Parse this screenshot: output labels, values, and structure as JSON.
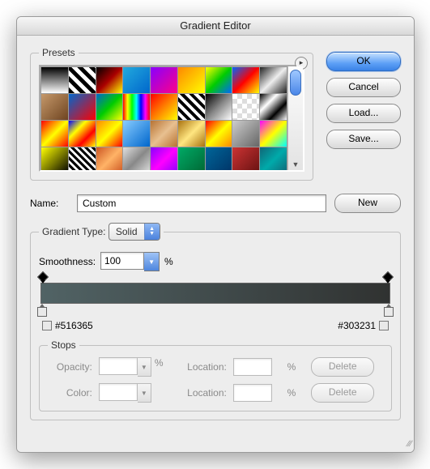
{
  "title": "Gradient Editor",
  "presets": {
    "legend": "Presets",
    "swatches": [
      "linear-gradient(#000,#fff)",
      "repeating-linear-gradient(45deg,#000 0 5px,#fff 5px 10px)",
      "linear-gradient(135deg,#000,#a00,#ff0)",
      "linear-gradient(135deg,#2ad,#06c)",
      "linear-gradient(135deg,#80f,#f08)",
      "linear-gradient(135deg,#f80,#ff0)",
      "linear-gradient(135deg,#ff0,#0c0,#06f)",
      "linear-gradient(135deg,#06f,#f00,#ff0)",
      "linear-gradient(135deg,#222,#eee,#222)",
      "linear-gradient(135deg,#c5986a,#6e4420)",
      "linear-gradient(135deg,#06c,#f00)",
      "linear-gradient(135deg,#06c,#0c0,#ff0)",
      "linear-gradient(90deg,#f00,#ff0,#0f0,#0ff,#00f,#f0f,#f00)",
      "linear-gradient(135deg,#f00,#ff0)",
      "repeating-linear-gradient(45deg,#000 0 4px,#fff 4px 8px)",
      "linear-gradient(135deg,#000,#888,#fff)",
      "repeating-conic-gradient(#ddd 0 25%,#fff 0 50%)",
      "linear-gradient(135deg,#000,#fff,#000,#fff)",
      "linear-gradient(135deg,#f00,#ff0,#f00)",
      "linear-gradient(135deg,#00f,#ff0,#f00,#ff0)",
      "linear-gradient(135deg,#f80,#ff0,#f00)",
      "linear-gradient(135deg,#8cf,#06c)",
      "linear-gradient(135deg,#b87333,#e8c090,#b87333)",
      "linear-gradient(135deg,#a9720f,#ffe681,#a9720f)",
      "linear-gradient(135deg,#f00,#ff0,#f80)",
      "linear-gradient(135deg,#ccc,#666)",
      "linear-gradient(135deg,#f0f,#ff0,#0ff)",
      "linear-gradient(135deg,#ff0,#000)",
      "repeating-linear-gradient(45deg,#000 0 3px,#fff 3px 6px)",
      "linear-gradient(135deg,#c52,#ffb366,#c52)",
      "linear-gradient(135deg,#e0e0e0,#888,#e0e0e0)",
      "linear-gradient(135deg,#80f,#f0f,#80f)",
      "linear-gradient(135deg,#0a6,#063)",
      "linear-gradient(135deg,#069,#036)",
      "linear-gradient(135deg,#c33,#611)",
      "linear-gradient(135deg,#167,#0aa,#167)"
    ]
  },
  "buttons": {
    "ok": "OK",
    "cancel": "Cancel",
    "load": "Load...",
    "save": "Save...",
    "new": "New",
    "delete": "Delete"
  },
  "name": {
    "label": "Name:",
    "value": "Custom"
  },
  "gradient_type": {
    "legend_prefix": "Gradient Type:",
    "value": "Solid"
  },
  "smoothness": {
    "label": "Smoothness:",
    "value": "100",
    "unit": "%"
  },
  "gradient": {
    "start_hex": "#516365",
    "end_hex": "#303231"
  },
  "stops": {
    "legend": "Stops",
    "opacity_label": "Opacity:",
    "color_label": "Color:",
    "location_label": "Location:",
    "pct": "%"
  }
}
